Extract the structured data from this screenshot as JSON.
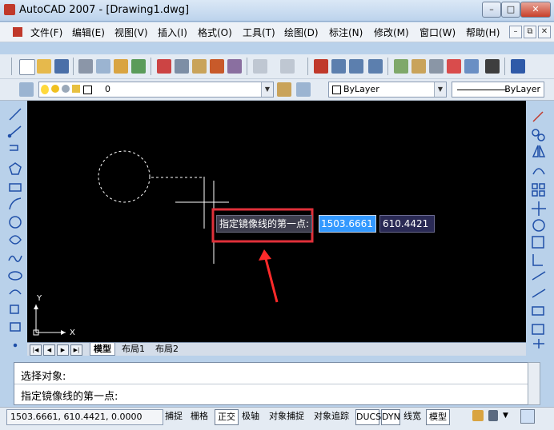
{
  "window": {
    "title": "AutoCAD 2007 - [Drawing1.dwg]",
    "minimize": "–",
    "maximize": "□",
    "close": "✕"
  },
  "menu": {
    "items": [
      "文件(F)",
      "编辑(E)",
      "视图(V)",
      "插入(I)",
      "格式(O)",
      "工具(T)",
      "绘图(D)",
      "标注(N)",
      "修改(M)",
      "窗口(W)",
      "帮助(H)"
    ],
    "mdi_minimize": "–",
    "mdi_restore": "⧉",
    "mdi_close": "✕"
  },
  "toolbar": {
    "layer_value": "0",
    "color_value": "ByLayer",
    "linetype_value": "ByLayer",
    "dropdown_arrow": "▼"
  },
  "canvas": {
    "prompt": "指定镜像线的第一点:",
    "x_value": "1503.6661",
    "y_value": "610.4421",
    "axis_x": "X",
    "axis_y": "Y",
    "colors": {
      "accent_highlight": "#e0303a",
      "input_selected": "#3399ff"
    }
  },
  "tabs": {
    "nav": [
      "|◀",
      "◀",
      "▶",
      "▶|"
    ],
    "items": [
      "模型",
      "布局1",
      "布局2"
    ]
  },
  "command": {
    "line1": "选择对象:",
    "line2": "指定镜像线的第一点:"
  },
  "status": {
    "coords": "1503.6661, 610.4421, 0.0000",
    "buttons": [
      "捕捉",
      "栅格",
      "正交",
      "极轴",
      "对象捕捉",
      "对象追踪",
      "DUCS",
      "DYN",
      "线宽",
      "模型"
    ],
    "on": [
      "正交",
      "DUCS",
      "DYN",
      "模型"
    ]
  }
}
